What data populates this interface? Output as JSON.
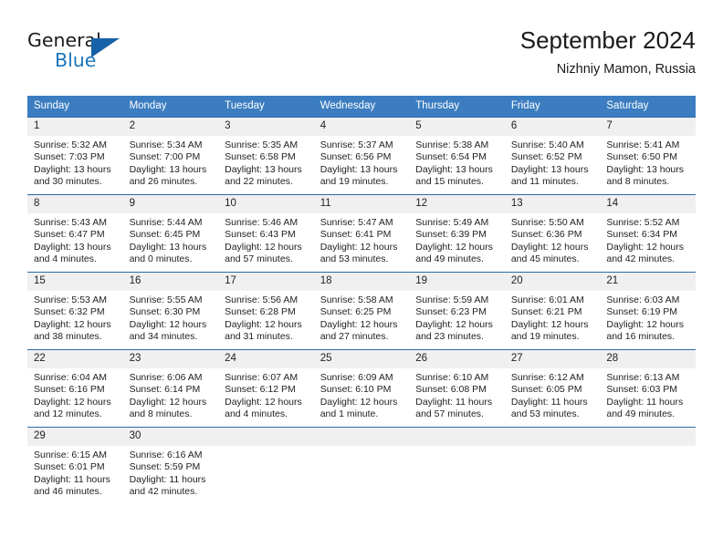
{
  "brand": {
    "line1": "General",
    "line2": "Blue",
    "triangle_color": "#1761a8",
    "blue_color": "#1975bb"
  },
  "header": {
    "title": "September 2024",
    "subtitle": "Nizhniy Mamon, Russia"
  },
  "theme": {
    "header_bg": "#3b7dc0",
    "row_border": "#2d6aa8",
    "daynum_bg": "#f0f0f0",
    "text": "#222222"
  },
  "labels": {
    "sunrise": "Sunrise:",
    "sunset": "Sunset:",
    "daylight": "Daylight:"
  },
  "weekdays": [
    "Sunday",
    "Monday",
    "Tuesday",
    "Wednesday",
    "Thursday",
    "Friday",
    "Saturday"
  ],
  "weeks": [
    [
      {
        "day": "1",
        "sunrise": "Sunrise: 5:32 AM",
        "sunset": "Sunset: 7:03 PM",
        "daylight1": "Daylight: 13 hours",
        "daylight2": "and 30 minutes."
      },
      {
        "day": "2",
        "sunrise": "Sunrise: 5:34 AM",
        "sunset": "Sunset: 7:00 PM",
        "daylight1": "Daylight: 13 hours",
        "daylight2": "and 26 minutes."
      },
      {
        "day": "3",
        "sunrise": "Sunrise: 5:35 AM",
        "sunset": "Sunset: 6:58 PM",
        "daylight1": "Daylight: 13 hours",
        "daylight2": "and 22 minutes."
      },
      {
        "day": "4",
        "sunrise": "Sunrise: 5:37 AM",
        "sunset": "Sunset: 6:56 PM",
        "daylight1": "Daylight: 13 hours",
        "daylight2": "and 19 minutes."
      },
      {
        "day": "5",
        "sunrise": "Sunrise: 5:38 AM",
        "sunset": "Sunset: 6:54 PM",
        "daylight1": "Daylight: 13 hours",
        "daylight2": "and 15 minutes."
      },
      {
        "day": "6",
        "sunrise": "Sunrise: 5:40 AM",
        "sunset": "Sunset: 6:52 PM",
        "daylight1": "Daylight: 13 hours",
        "daylight2": "and 11 minutes."
      },
      {
        "day": "7",
        "sunrise": "Sunrise: 5:41 AM",
        "sunset": "Sunset: 6:50 PM",
        "daylight1": "Daylight: 13 hours",
        "daylight2": "and 8 minutes."
      }
    ],
    [
      {
        "day": "8",
        "sunrise": "Sunrise: 5:43 AM",
        "sunset": "Sunset: 6:47 PM",
        "daylight1": "Daylight: 13 hours",
        "daylight2": "and 4 minutes."
      },
      {
        "day": "9",
        "sunrise": "Sunrise: 5:44 AM",
        "sunset": "Sunset: 6:45 PM",
        "daylight1": "Daylight: 13 hours",
        "daylight2": "and 0 minutes."
      },
      {
        "day": "10",
        "sunrise": "Sunrise: 5:46 AM",
        "sunset": "Sunset: 6:43 PM",
        "daylight1": "Daylight: 12 hours",
        "daylight2": "and 57 minutes."
      },
      {
        "day": "11",
        "sunrise": "Sunrise: 5:47 AM",
        "sunset": "Sunset: 6:41 PM",
        "daylight1": "Daylight: 12 hours",
        "daylight2": "and 53 minutes."
      },
      {
        "day": "12",
        "sunrise": "Sunrise: 5:49 AM",
        "sunset": "Sunset: 6:39 PM",
        "daylight1": "Daylight: 12 hours",
        "daylight2": "and 49 minutes."
      },
      {
        "day": "13",
        "sunrise": "Sunrise: 5:50 AM",
        "sunset": "Sunset: 6:36 PM",
        "daylight1": "Daylight: 12 hours",
        "daylight2": "and 45 minutes."
      },
      {
        "day": "14",
        "sunrise": "Sunrise: 5:52 AM",
        "sunset": "Sunset: 6:34 PM",
        "daylight1": "Daylight: 12 hours",
        "daylight2": "and 42 minutes."
      }
    ],
    [
      {
        "day": "15",
        "sunrise": "Sunrise: 5:53 AM",
        "sunset": "Sunset: 6:32 PM",
        "daylight1": "Daylight: 12 hours",
        "daylight2": "and 38 minutes."
      },
      {
        "day": "16",
        "sunrise": "Sunrise: 5:55 AM",
        "sunset": "Sunset: 6:30 PM",
        "daylight1": "Daylight: 12 hours",
        "daylight2": "and 34 minutes."
      },
      {
        "day": "17",
        "sunrise": "Sunrise: 5:56 AM",
        "sunset": "Sunset: 6:28 PM",
        "daylight1": "Daylight: 12 hours",
        "daylight2": "and 31 minutes."
      },
      {
        "day": "18",
        "sunrise": "Sunrise: 5:58 AM",
        "sunset": "Sunset: 6:25 PM",
        "daylight1": "Daylight: 12 hours",
        "daylight2": "and 27 minutes."
      },
      {
        "day": "19",
        "sunrise": "Sunrise: 5:59 AM",
        "sunset": "Sunset: 6:23 PM",
        "daylight1": "Daylight: 12 hours",
        "daylight2": "and 23 minutes."
      },
      {
        "day": "20",
        "sunrise": "Sunrise: 6:01 AM",
        "sunset": "Sunset: 6:21 PM",
        "daylight1": "Daylight: 12 hours",
        "daylight2": "and 19 minutes."
      },
      {
        "day": "21",
        "sunrise": "Sunrise: 6:03 AM",
        "sunset": "Sunset: 6:19 PM",
        "daylight1": "Daylight: 12 hours",
        "daylight2": "and 16 minutes."
      }
    ],
    [
      {
        "day": "22",
        "sunrise": "Sunrise: 6:04 AM",
        "sunset": "Sunset: 6:16 PM",
        "daylight1": "Daylight: 12 hours",
        "daylight2": "and 12 minutes."
      },
      {
        "day": "23",
        "sunrise": "Sunrise: 6:06 AM",
        "sunset": "Sunset: 6:14 PM",
        "daylight1": "Daylight: 12 hours",
        "daylight2": "and 8 minutes."
      },
      {
        "day": "24",
        "sunrise": "Sunrise: 6:07 AM",
        "sunset": "Sunset: 6:12 PM",
        "daylight1": "Daylight: 12 hours",
        "daylight2": "and 4 minutes."
      },
      {
        "day": "25",
        "sunrise": "Sunrise: 6:09 AM",
        "sunset": "Sunset: 6:10 PM",
        "daylight1": "Daylight: 12 hours",
        "daylight2": "and 1 minute."
      },
      {
        "day": "26",
        "sunrise": "Sunrise: 6:10 AM",
        "sunset": "Sunset: 6:08 PM",
        "daylight1": "Daylight: 11 hours",
        "daylight2": "and 57 minutes."
      },
      {
        "day": "27",
        "sunrise": "Sunrise: 6:12 AM",
        "sunset": "Sunset: 6:05 PM",
        "daylight1": "Daylight: 11 hours",
        "daylight2": "and 53 minutes."
      },
      {
        "day": "28",
        "sunrise": "Sunrise: 6:13 AM",
        "sunset": "Sunset: 6:03 PM",
        "daylight1": "Daylight: 11 hours",
        "daylight2": "and 49 minutes."
      }
    ],
    [
      {
        "day": "29",
        "sunrise": "Sunrise: 6:15 AM",
        "sunset": "Sunset: 6:01 PM",
        "daylight1": "Daylight: 11 hours",
        "daylight2": "and 46 minutes."
      },
      {
        "day": "30",
        "sunrise": "Sunrise: 6:16 AM",
        "sunset": "Sunset: 5:59 PM",
        "daylight1": "Daylight: 11 hours",
        "daylight2": "and 42 minutes."
      },
      {
        "day": "",
        "sunrise": "",
        "sunset": "",
        "daylight1": "",
        "daylight2": ""
      },
      {
        "day": "",
        "sunrise": "",
        "sunset": "",
        "daylight1": "",
        "daylight2": ""
      },
      {
        "day": "",
        "sunrise": "",
        "sunset": "",
        "daylight1": "",
        "daylight2": ""
      },
      {
        "day": "",
        "sunrise": "",
        "sunset": "",
        "daylight1": "",
        "daylight2": ""
      },
      {
        "day": "",
        "sunrise": "",
        "sunset": "",
        "daylight1": "",
        "daylight2": ""
      }
    ]
  ]
}
